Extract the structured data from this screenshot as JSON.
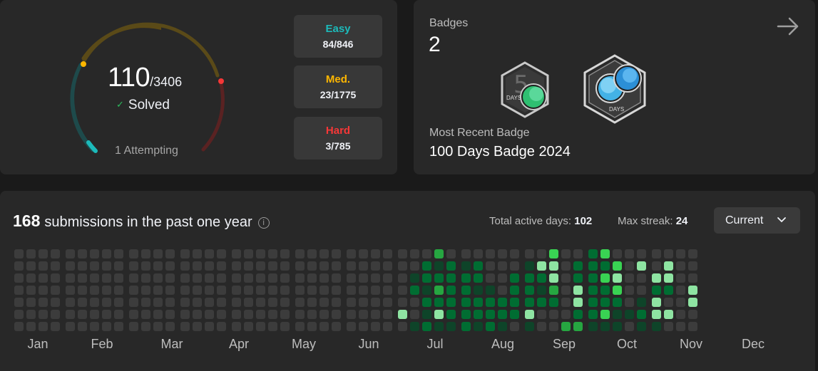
{
  "solved": {
    "count": "110",
    "total": "/3406",
    "label": "Solved",
    "attempting": "1 Attempting",
    "ring_colors": {
      "easy": "#1cbaba",
      "medium": "#ffb700",
      "hard": "#f63737"
    },
    "difficulties": [
      {
        "label": "Easy",
        "value": "84/846",
        "color": "#1cbaba"
      },
      {
        "label": "Med.",
        "value": "23/1775",
        "color": "#ffb700"
      },
      {
        "label": "Hard",
        "value": "3/785",
        "color": "#f63737"
      }
    ]
  },
  "badges": {
    "title": "Badges",
    "count": "2",
    "icon1_text": "DAYS",
    "icon2_text": "DAYS",
    "recent_label": "Most Recent Badge",
    "recent_name": "100 Days Badge 2024"
  },
  "submissions": {
    "count": "168",
    "title": "submissions in the past one year",
    "active_label": "Total active days: ",
    "active_value": "102",
    "streak_label": "Max streak: ",
    "streak_value": "24",
    "select_value": "Current",
    "months": [
      "Jan",
      "Feb",
      "Mar",
      "Apr",
      "May",
      "Jun",
      "Jul",
      "Aug",
      "Sep",
      "Oct",
      "Nov",
      "Dec"
    ],
    "heat_colors": [
      "#3c3c3c",
      "#0e4429",
      "#006d32",
      "#26a641",
      "#39d353",
      "#8ee4a2"
    ],
    "weeks": [
      [
        0,
        0,
        0,
        0,
        0,
        0,
        0
      ],
      [
        0,
        0,
        0,
        0,
        0,
        0,
        0
      ],
      [
        0,
        0,
        0,
        0,
        0,
        0,
        0
      ],
      [
        0,
        0,
        0,
        0,
        0,
        0,
        0
      ],
      [
        0,
        0,
        0,
        0,
        0,
        0,
        0
      ],
      [
        0,
        0,
        0,
        0,
        0,
        0,
        0
      ],
      [
        0,
        0,
        0,
        0,
        0,
        0,
        0
      ],
      [
        0,
        0,
        0,
        0,
        0,
        0,
        0
      ],
      [
        0,
        0,
        0,
        0,
        0,
        0,
        0
      ],
      [
        0,
        0,
        0,
        0,
        0,
        0,
        0
      ],
      [
        0,
        0,
        0,
        0,
        0,
        0,
        0
      ],
      [
        0,
        0,
        0,
        0,
        0,
        0,
        0
      ],
      [
        0,
        0,
        0,
        0,
        0,
        0,
        0
      ],
      [
        0,
        0,
        0,
        0,
        0,
        0,
        0
      ],
      [
        0,
        0,
        0,
        0,
        0,
        0,
        0
      ],
      [
        0,
        0,
        0,
        0,
        0,
        0,
        0
      ],
      [
        0,
        0,
        0,
        0,
        0,
        0,
        0
      ],
      [
        0,
        0,
        0,
        0,
        0,
        0,
        0
      ],
      [
        0,
        0,
        0,
        0,
        0,
        0,
        0
      ],
      [
        0,
        0,
        0,
        0,
        0,
        0,
        0
      ],
      [
        0,
        0,
        0,
        0,
        0,
        0,
        0
      ],
      [
        0,
        0,
        0,
        0,
        0,
        0,
        0
      ],
      [
        0,
        0,
        0,
        0,
        0,
        0,
        0
      ],
      [
        0,
        0,
        0,
        0,
        0,
        0,
        0
      ],
      [
        0,
        0,
        0,
        0,
        0,
        0,
        0
      ],
      [
        0,
        0,
        0,
        0,
        0,
        0,
        0
      ],
      [
        0,
        0,
        0,
        0,
        0,
        0,
        0
      ],
      [
        0,
        0,
        0,
        0,
        0,
        0,
        0
      ],
      [
        0,
        0,
        0,
        0,
        0,
        0,
        0
      ],
      [
        0,
        0,
        0,
        0,
        0,
        0,
        0
      ],
      [
        0,
        0,
        0,
        0,
        0,
        5,
        0
      ],
      [
        0,
        0,
        1,
        2,
        0,
        0,
        1
      ],
      [
        0,
        2,
        2,
        1,
        2,
        1,
        2
      ],
      [
        3,
        1,
        2,
        3,
        2,
        5,
        1
      ],
      [
        0,
        2,
        2,
        2,
        2,
        2,
        1
      ],
      [
        0,
        1,
        2,
        2,
        2,
        2,
        2
      ],
      [
        0,
        2,
        2,
        1,
        2,
        2,
        1
      ],
      [
        0,
        0,
        0,
        1,
        2,
        2,
        2
      ],
      [
        0,
        0,
        0,
        0,
        2,
        2,
        1
      ],
      [
        0,
        0,
        2,
        2,
        2,
        2,
        0
      ],
      [
        0,
        1,
        2,
        2,
        2,
        5,
        1
      ],
      [
        0,
        5,
        2,
        1,
        2,
        0,
        0
      ],
      [
        4,
        5,
        5,
        3,
        2,
        0,
        0
      ],
      [
        0,
        0,
        0,
        0,
        0,
        0,
        3
      ],
      [
        0,
        2,
        2,
        5,
        5,
        2,
        3
      ],
      [
        2,
        2,
        2,
        2,
        2,
        2,
        1
      ],
      [
        4,
        2,
        4,
        2,
        2,
        4,
        1
      ],
      [
        0,
        4,
        5,
        4,
        2,
        1,
        1
      ],
      [
        0,
        0,
        0,
        0,
        0,
        1,
        0
      ],
      [
        0,
        5,
        0,
        0,
        1,
        2,
        1
      ],
      [
        0,
        0,
        5,
        2,
        5,
        5,
        1
      ],
      [
        0,
        5,
        5,
        2,
        0,
        5,
        0
      ],
      [
        0,
        0,
        0,
        0,
        0,
        0,
        0
      ],
      [
        0,
        0,
        0,
        5,
        5,
        0,
        0
      ]
    ]
  }
}
